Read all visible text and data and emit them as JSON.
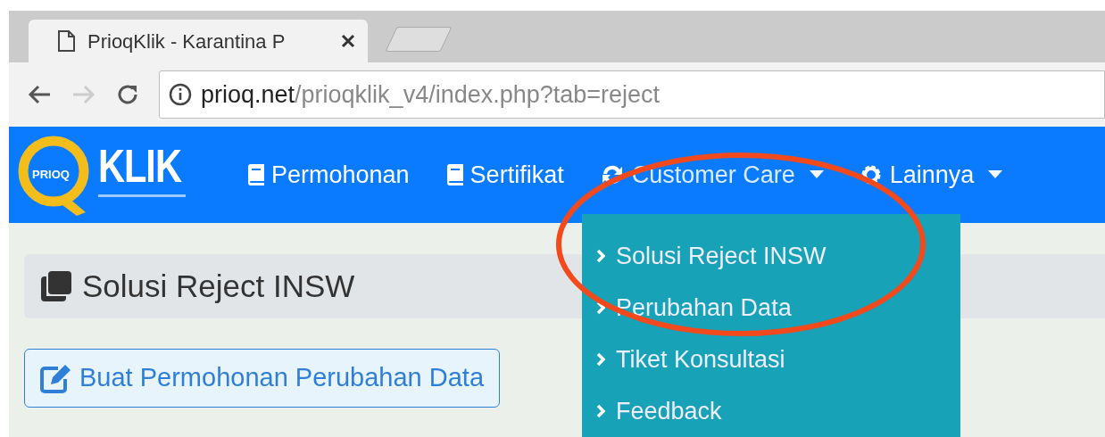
{
  "browser": {
    "tabs": [
      {
        "title": "PrioqKlik - Karantina P",
        "selected": true
      },
      {
        "selected": false
      }
    ],
    "url_host": "prioq.net",
    "url_path": "/prioqklik_v4/index.php?tab=reject"
  },
  "logo": {
    "badge": "PRIOQ",
    "word": "KLIK"
  },
  "nav": [
    {
      "label": "Permohonan",
      "kind": "book",
      "dropdown": false,
      "expanded": false
    },
    {
      "label": "Sertifikat",
      "kind": "book",
      "dropdown": false,
      "expanded": false
    },
    {
      "label": "Customer Care",
      "kind": "sync",
      "dropdown": true,
      "expanded": true
    },
    {
      "label": "Lainnya",
      "kind": "gear",
      "dropdown": true,
      "expanded": false
    }
  ],
  "dropdown_menu": [
    "Solusi Reject INSW",
    "Perubahan Data",
    "Tiket Konsultasi",
    "Feedback"
  ],
  "page_title": "Solusi Reject INSW",
  "action_button": "Buat Permohonan Perubahan Data"
}
